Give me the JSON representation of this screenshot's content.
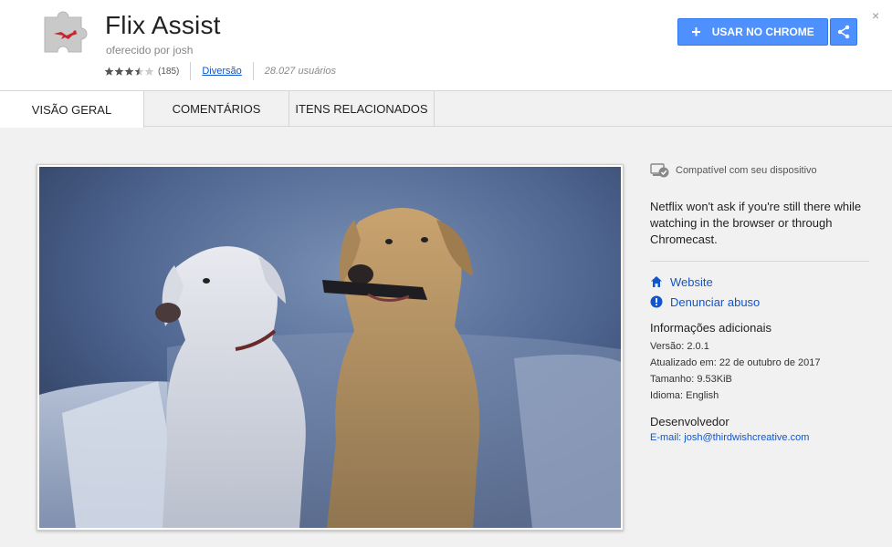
{
  "extension": {
    "name": "Flix Assist",
    "offered_by": "oferecido por josh",
    "rating_stars": 3.5,
    "rating_count": "(185)",
    "category": "Diversão",
    "users": "28.027 usuários"
  },
  "actions": {
    "add_label": "USAR NO CHROME",
    "add_icon": "plus-icon",
    "share_icon": "share-icon",
    "close_label": "×"
  },
  "tabs": [
    {
      "label": "VISÃO GERAL",
      "active": true
    },
    {
      "label": "COMENTÁRIOS",
      "active": false
    },
    {
      "label": "ITENS RELACIONADOS",
      "active": false
    }
  ],
  "sidebar": {
    "compat_text": "Compatível com seu dispositivo",
    "description": "Netflix won't ask if you're still there while watching in the browser or through Chromecast.",
    "website_label": "Website",
    "report_label": "Denunciar abuso",
    "info_heading": "Informações adicionais",
    "version": "Versão: 2.0.1",
    "updated": "Atualizado em:  22 de outubro de 2017",
    "size": "Tamanho: 9.53KiB",
    "language": "Idioma: English",
    "dev_heading": "Desenvolvedor",
    "dev_email": "E-mail:  josh@thirdwishcreative.com"
  },
  "colors": {
    "accent": "#4d90fe",
    "link": "#1155cc",
    "logo_red": "#c6262e"
  }
}
